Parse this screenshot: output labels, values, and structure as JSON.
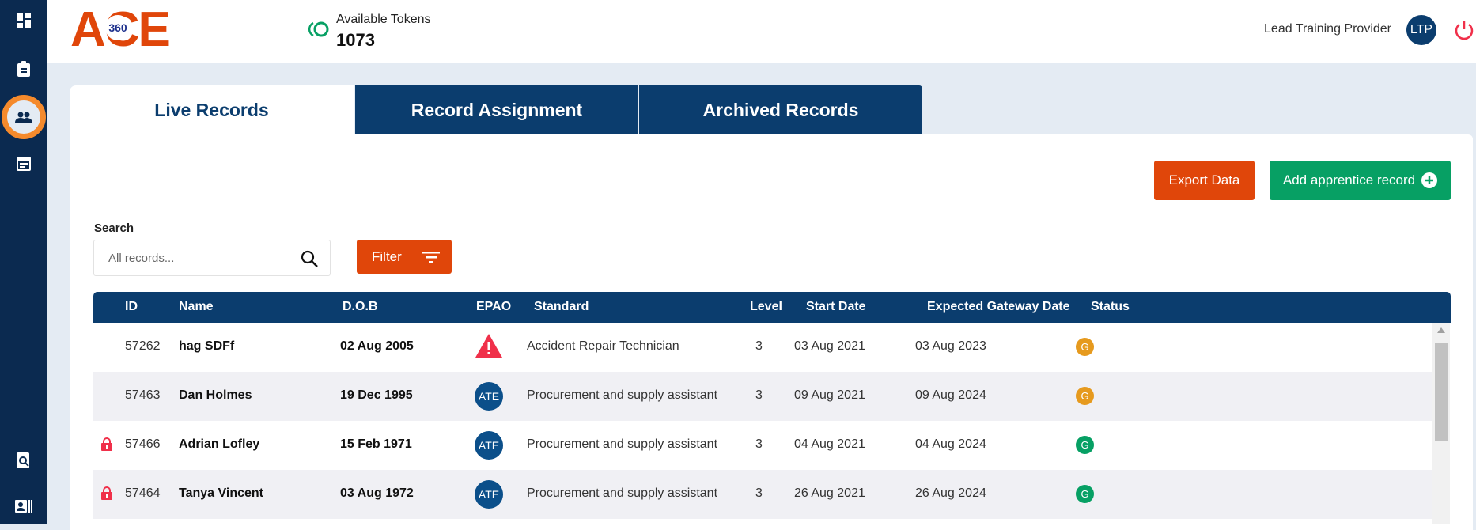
{
  "logo": {
    "text": "ACE",
    "badge": "360"
  },
  "tokens": {
    "label": "Available Tokens",
    "value": "1073"
  },
  "user": {
    "role": "Lead Training Provider",
    "initials": "LTP"
  },
  "sidebar": [
    "dashboard-icon",
    "clipboard-icon",
    "people-icon",
    "calendar-icon",
    "search-document-icon",
    "contact-card-icon"
  ],
  "tabs": [
    "Live Records",
    "Record Assignment",
    "Archived Records"
  ],
  "actions": {
    "export": "Export Data",
    "add": "Add apprentice record"
  },
  "search": {
    "label": "Search",
    "placeholder": "All records...",
    "value": ""
  },
  "filter": "Filter",
  "columns": [
    "ID",
    "Name",
    "D.O.B",
    "EPAO",
    "Standard",
    "Level",
    "Start Date",
    "Expected Gateway Date",
    "Status"
  ],
  "rows": [
    {
      "locked": false,
      "id": "57262",
      "name": "hag SDFf",
      "dob": "02 Aug 2005",
      "epao": "warning",
      "standard": "Accident Repair Technician",
      "level": "3",
      "start": "03 Aug 2021",
      "gateway": "03 Aug 2023",
      "status": "G",
      "status_color": "#e69a1e"
    },
    {
      "locked": false,
      "id": "57463",
      "name": "Dan Holmes",
      "dob": "19 Dec 1995",
      "epao": "ATE",
      "standard": "Procurement and supply assistant",
      "level": "3",
      "start": "09 Aug 2021",
      "gateway": "09 Aug 2024",
      "status": "G",
      "status_color": "#e69a1e"
    },
    {
      "locked": true,
      "id": "57466",
      "name": "Adrian Lofley",
      "dob": "15 Feb 1971",
      "epao": "ATE",
      "standard": "Procurement and supply assistant",
      "level": "3",
      "start": "04 Aug 2021",
      "gateway": "04 Aug 2024",
      "status": "G",
      "status_color": "#07a064"
    },
    {
      "locked": true,
      "id": "57464",
      "name": "Tanya Vincent",
      "dob": "03 Aug 1972",
      "epao": "ATE",
      "standard": "Procurement and supply assistant",
      "level": "3",
      "start": "26 Aug 2021",
      "gateway": "26 Aug 2024",
      "status": "G",
      "status_color": "#07a064"
    }
  ],
  "colors": {
    "navy": "#0b3d6e",
    "orange": "#e0460a",
    "green": "#07a064"
  }
}
